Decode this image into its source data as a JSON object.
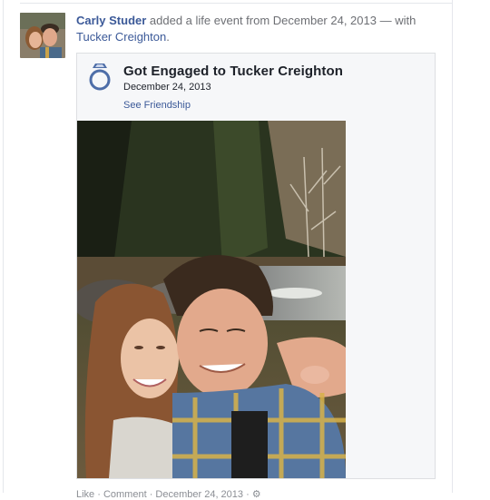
{
  "story": {
    "author": "Carly Studer",
    "action_text": " added a life event from December 24, 2013 — with ",
    "tagged": "Tucker Creighton",
    "end_punct": "."
  },
  "event": {
    "icon": "ring-icon",
    "title": "Got Engaged to Tucker Creighton",
    "date": "December 24, 2013",
    "link": "See Friendship"
  },
  "footer": {
    "peek": "Like · Comment · December 24, 2013 · ⚙"
  },
  "colors": {
    "link": "#3b5998",
    "text_gray": "#6d6f74",
    "card_bg": "#f6f7f9",
    "card_border": "#dddfe2",
    "ring_blue": "#4e6ea8"
  }
}
